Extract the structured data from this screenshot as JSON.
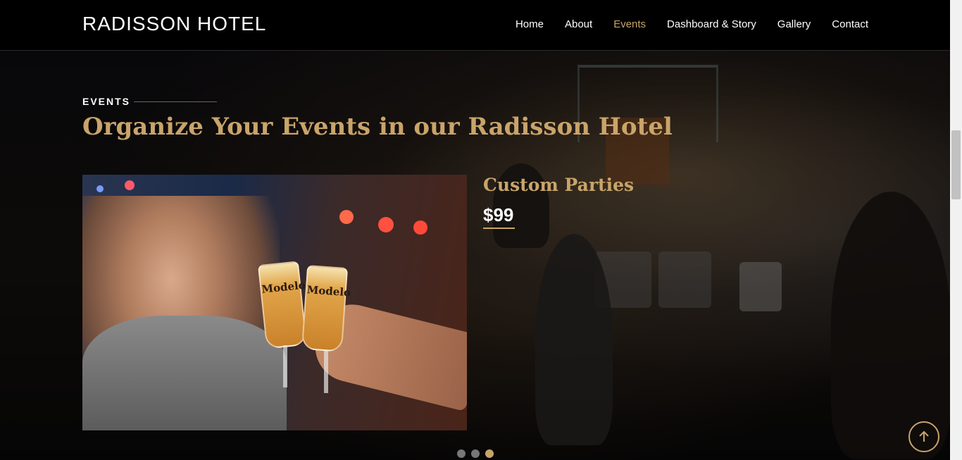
{
  "header": {
    "brand": "RADISSON HOTEL",
    "nav": [
      {
        "label": "Home",
        "active": false
      },
      {
        "label": "About",
        "active": false
      },
      {
        "label": "Events",
        "active": true
      },
      {
        "label": "Dashboard & Story",
        "active": false
      },
      {
        "label": "Gallery",
        "active": false
      },
      {
        "label": "Contact",
        "active": false
      }
    ]
  },
  "events_section": {
    "tag": "EVENTS",
    "title": "Organize Your Events in our Radisson Hotel",
    "current_event": {
      "name": "Custom Parties",
      "price": "$99",
      "photo_text": [
        "Modelo",
        "Modelo"
      ]
    },
    "carousel": {
      "slide_count": 3,
      "active_index": 2
    }
  },
  "icons": {
    "back_to_top": "arrow-up-icon"
  },
  "colors": {
    "accent": "#c9a46a",
    "background": "#000000",
    "text": "#ffffff"
  }
}
